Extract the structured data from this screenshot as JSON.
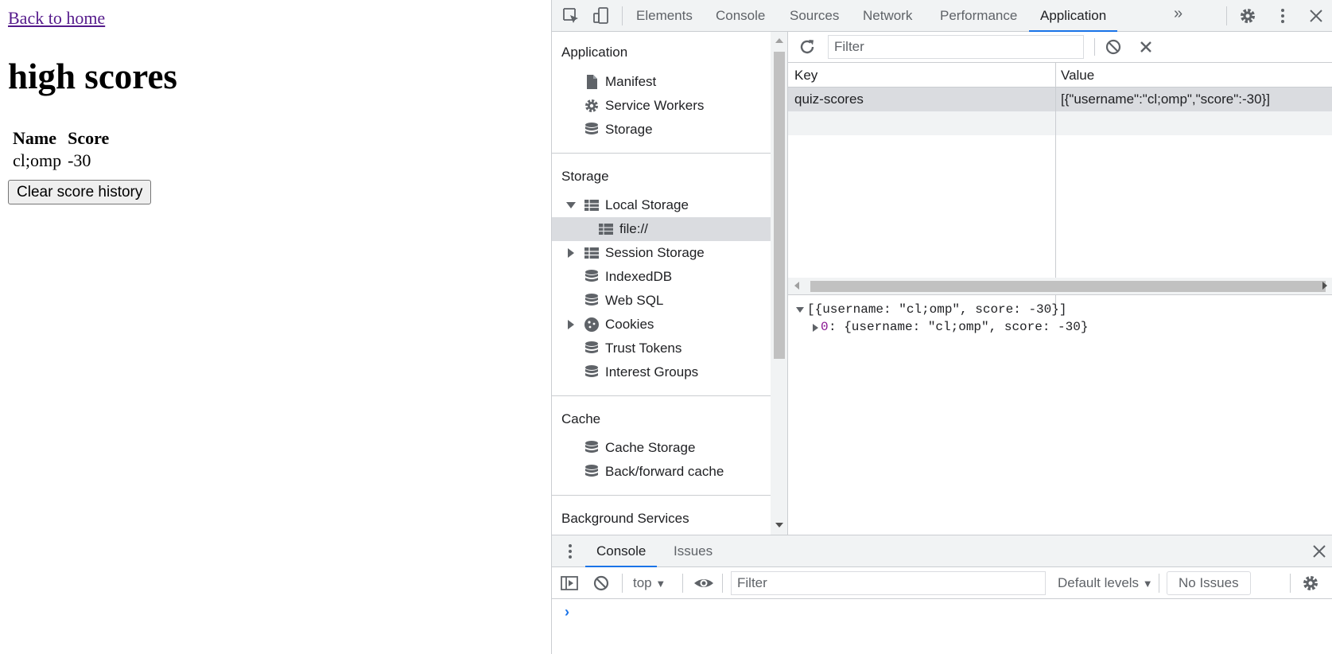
{
  "page": {
    "back_link": "Back to home",
    "heading": "high scores",
    "table": {
      "headers": [
        "Name",
        "Score"
      ],
      "rows": [
        [
          "cl;omp",
          "-30"
        ]
      ]
    },
    "clear_button": "Clear score history"
  },
  "devtools": {
    "tabs": [
      "Elements",
      "Console",
      "Sources",
      "Network",
      "Performance",
      "Application"
    ],
    "active_tab": "Application",
    "more_tabs": "»",
    "sidebar": {
      "application": {
        "title": "Application",
        "items": [
          "Manifest",
          "Service Workers",
          "Storage"
        ]
      },
      "storage": {
        "title": "Storage",
        "local_storage": "Local Storage",
        "local_storage_child": "file://",
        "session_storage": "Session Storage",
        "indexeddb": "IndexedDB",
        "websql": "Web SQL",
        "cookies": "Cookies",
        "trust_tokens": "Trust Tokens",
        "interest_groups": "Interest Groups"
      },
      "cache": {
        "title": "Cache",
        "items": [
          "Cache Storage",
          "Back/forward cache"
        ]
      },
      "background": {
        "title": "Background Services"
      }
    },
    "storage_view": {
      "filter_placeholder": "Filter",
      "columns": {
        "key": "Key",
        "value": "Value"
      },
      "rows": [
        {
          "key": "quiz-scores",
          "value": "[{\"username\":\"cl;omp\",\"score\":-30}]"
        }
      ],
      "preview": {
        "root": "[{username: \"cl;omp\", score: -30}]",
        "child_index": "0",
        "child_value": ": {username: \"cl;omp\", score: -30}"
      }
    },
    "drawer": {
      "tabs": [
        "Console",
        "Issues"
      ],
      "active_tab": "Console",
      "context": "top",
      "filter_placeholder": "Filter",
      "levels": "Default levels",
      "issues": "No Issues",
      "prompt": "›"
    }
  },
  "colors": {
    "accent": "#1a73e8",
    "selected_row": "#dadce0",
    "visited_link": "#551a8b"
  }
}
